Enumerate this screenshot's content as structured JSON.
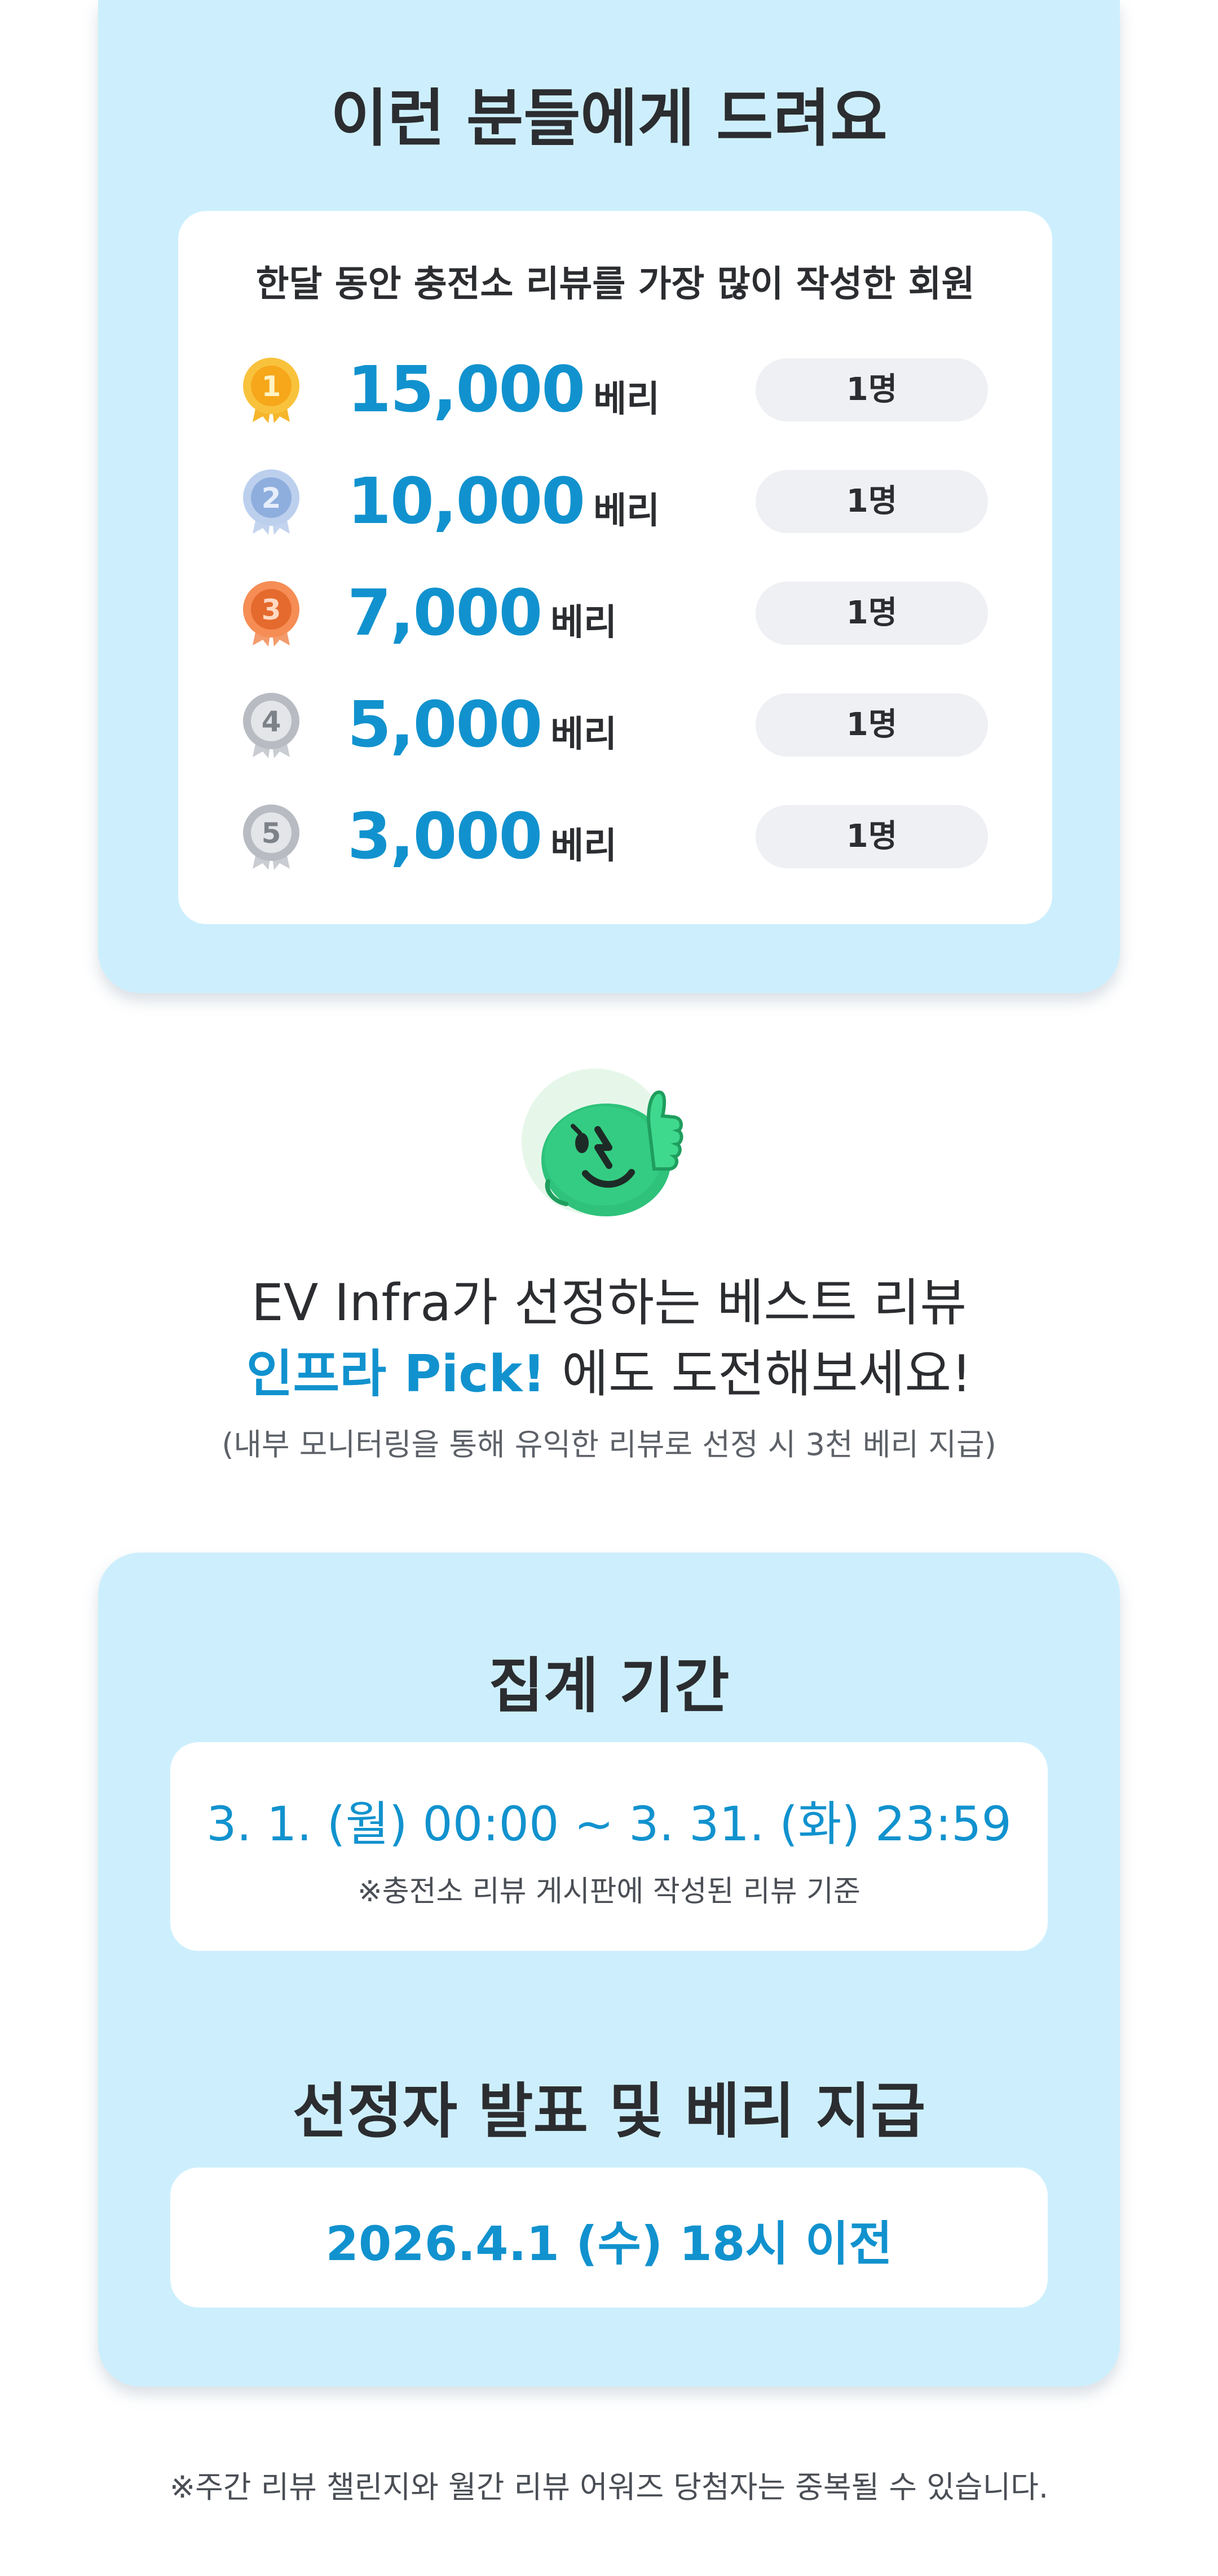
{
  "target": {
    "title": "이런 분들에게 드려요",
    "subtitle": "한달 동안 충전소 리뷰를 가장 많이 작성한 회원",
    "ranks": [
      {
        "rank": "1",
        "amount": "15,000",
        "unit": "베리",
        "count": "1명"
      },
      {
        "rank": "2",
        "amount": "10,000",
        "unit": "베리",
        "count": "1명"
      },
      {
        "rank": "3",
        "amount": "7,000",
        "unit": "베리",
        "count": "1명"
      },
      {
        "rank": "4",
        "amount": "5,000",
        "unit": "베리",
        "count": "1명"
      },
      {
        "rank": "5",
        "amount": "3,000",
        "unit": "베리",
        "count": "1명"
      }
    ]
  },
  "pick": {
    "line1": "EV Infra가 선정하는 베스트 리뷰",
    "line2_highlight": "인프라 Pick!",
    "line2_rest": " 에도 도전해보세요!",
    "note": "(내부 모니터링을 통해 유익한 리뷰로 선정 시 3천 베리 지급)"
  },
  "period": {
    "title": "집계 기간",
    "range": "3. 1. (월) 00:00 ~ 3. 31. (화) 23:59",
    "range_note": "※충전소 리뷰 게시판에 작성된 리뷰 기준",
    "announce_title": "선정자 발표 및 베리 지급",
    "announce_date": "2026.4.1 (수) 18시 이전"
  },
  "footer_note": "※주간 리뷰 챌린지와 월간 리뷰 어워즈 당첨자는 중복될 수 있습니다.",
  "colors": {
    "card_bg": "#cdeffd",
    "accent_blue": "#1192ce",
    "gold": "#f6b62c",
    "silver_blue": "#9fb9e0",
    "bronze": "#f08048",
    "gray": "#a9adb3",
    "mascot_green": "#28c274"
  },
  "icons": {
    "medals": [
      "gold-medal-icon",
      "blue-medal-icon",
      "bronze-medal-icon",
      "gray-medal-icon",
      "gray-medal-icon"
    ],
    "mascot": "thumbs-up-mascot"
  }
}
